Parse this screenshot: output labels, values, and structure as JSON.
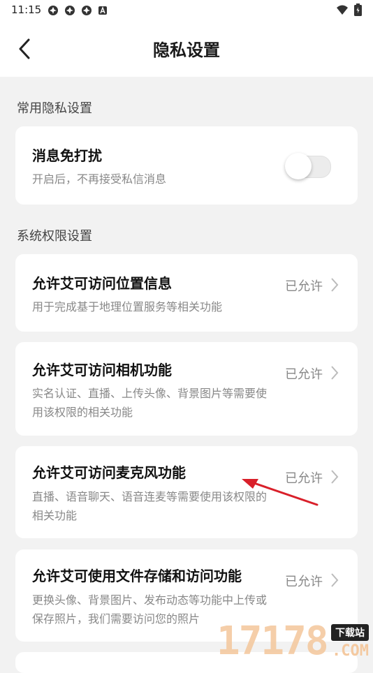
{
  "status_bar": {
    "time": "11:15",
    "left_icons": [
      "notification-icon",
      "notification-icon",
      "notification-icon",
      "a-icon"
    ],
    "right_icons": [
      "wifi-icon",
      "battery-icon"
    ]
  },
  "header": {
    "title": "隐私设置",
    "back_icon": "back-arrow-icon"
  },
  "sections": {
    "common": {
      "label": "常用隐私设置"
    },
    "system": {
      "label": "系统权限设置"
    }
  },
  "dnd": {
    "title": "消息免打扰",
    "desc": "开启后，不再接受私信消息",
    "toggle_on": false
  },
  "permissions": [
    {
      "title": "允许艾可访问位置信息",
      "desc": "用于完成基于地理位置服务等相关功能",
      "status": "已允许"
    },
    {
      "title": "允许艾可访问相机功能",
      "desc": "实名认证、直播、上传头像、背景图片等需要使用该权限的相关功能",
      "status": "已允许"
    },
    {
      "title": "允许艾可访问麦克风功能",
      "desc": "直播、语音聊天、语音连麦等需要使用该权限的相关功能",
      "status": "已允许"
    },
    {
      "title": "允许艾可使用文件存储和访问功能",
      "desc": "更换头像、背景图片、发布动态等功能中上传或保存照片，我们需要访问您的照片",
      "status": "已允许"
    }
  ],
  "watermark": {
    "number": "17178",
    "badge": "下载站",
    "domain": ".COM"
  },
  "colors": {
    "background": "#f2f2f2",
    "card": "#ffffff",
    "annotation_arrow": "#d9202a"
  }
}
